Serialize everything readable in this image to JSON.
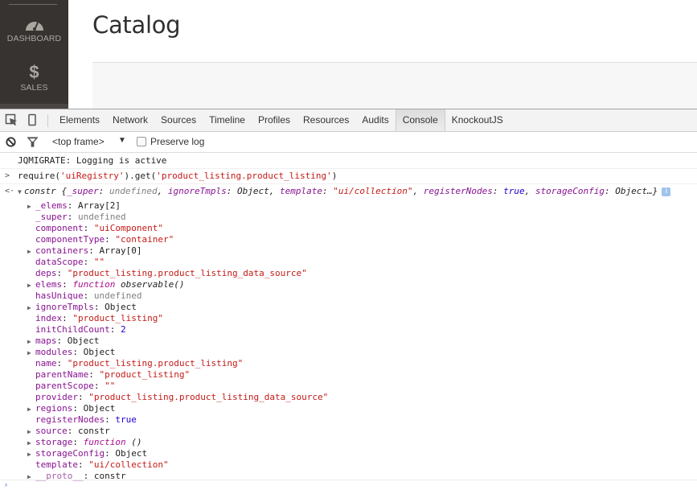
{
  "admin": {
    "sidebar": {
      "items": [
        {
          "label": "DASHBOARD",
          "icon": "gauge-icon"
        },
        {
          "label": "SALES",
          "icon": "dollar-icon",
          "glyph": "$"
        }
      ]
    },
    "page_title": "Catalog"
  },
  "devtools": {
    "tools": [
      "inspect-element-icon",
      "device-mode-icon"
    ],
    "tabs": [
      {
        "label": "Elements",
        "active": false
      },
      {
        "label": "Network",
        "active": false
      },
      {
        "label": "Sources",
        "active": false
      },
      {
        "label": "Timeline",
        "active": false
      },
      {
        "label": "Profiles",
        "active": false
      },
      {
        "label": "Resources",
        "active": false
      },
      {
        "label": "Audits",
        "active": false
      },
      {
        "label": "Console",
        "active": true
      },
      {
        "label": "KnockoutJS",
        "active": false
      }
    ],
    "toolbar": {
      "frame": "<top frame>",
      "frame_arrow": "▼",
      "preserve_log_label": "Preserve log",
      "preserve_log_checked": false
    },
    "console": {
      "log_message": "JQMIGRATE: Logging is active",
      "command_prompt": ">",
      "command": {
        "prefix": "require(",
        "arg1": "'uiRegistry'",
        "mid": ").get(",
        "arg2": "'product_listing.product_listing'",
        "suffix": ")"
      },
      "result_prompt": "<·",
      "result_summary": {
        "name": "constr",
        "open": " {",
        "p1k": "_super",
        "p1v": "undefined",
        "p2k": "ignoreTmpls",
        "p2v": "Object",
        "p3k": "template",
        "p3v": "\"ui/collection\"",
        "p4k": "registerNodes",
        "p4v": "true",
        "p5k": "storageConfig",
        "p5v": "Object…}",
        "info": "i"
      },
      "properties": [
        {
          "key": "_elems",
          "value": "Array[2]",
          "type": "obj",
          "expandable": true
        },
        {
          "key": "_super",
          "value": "undefined",
          "type": "undef",
          "expandable": false
        },
        {
          "key": "component",
          "value": "\"uiComponent\"",
          "type": "str",
          "expandable": false
        },
        {
          "key": "componentType",
          "value": "\"container\"",
          "type": "str",
          "expandable": false
        },
        {
          "key": "containers",
          "value": "Array[0]",
          "type": "obj",
          "expandable": true
        },
        {
          "key": "dataScope",
          "value": "\"\"",
          "type": "str",
          "expandable": false
        },
        {
          "key": "deps",
          "value": "\"product_listing.product_listing_data_source\"",
          "type": "str",
          "expandable": false
        },
        {
          "key": "elems",
          "value": "function",
          "value2": " observable()",
          "type": "fn",
          "expandable": true
        },
        {
          "key": "hasUnique",
          "value": "undefined",
          "type": "undef",
          "expandable": false
        },
        {
          "key": "ignoreTmpls",
          "value": "Object",
          "type": "obj",
          "expandable": true
        },
        {
          "key": "index",
          "value": "\"product_listing\"",
          "type": "str",
          "expandable": false
        },
        {
          "key": "initChildCount",
          "value": "2",
          "type": "num",
          "expandable": false
        },
        {
          "key": "maps",
          "value": "Object",
          "type": "obj",
          "expandable": true
        },
        {
          "key": "modules",
          "value": "Object",
          "type": "obj",
          "expandable": true
        },
        {
          "key": "name",
          "value": "\"product_listing.product_listing\"",
          "type": "str",
          "expandable": false
        },
        {
          "key": "parentName",
          "value": "\"product_listing\"",
          "type": "str",
          "expandable": false
        },
        {
          "key": "parentScope",
          "value": "\"\"",
          "type": "str",
          "expandable": false
        },
        {
          "key": "provider",
          "value": "\"product_listing.product_listing_data_source\"",
          "type": "str",
          "expandable": false
        },
        {
          "key": "regions",
          "value": "Object",
          "type": "obj",
          "expandable": true
        },
        {
          "key": "registerNodes",
          "value": "true",
          "type": "num",
          "expandable": false
        },
        {
          "key": "source",
          "value": "constr",
          "type": "obj",
          "expandable": true
        },
        {
          "key": "storage",
          "value": "function",
          "value2": " ()",
          "type": "fn",
          "expandable": true
        },
        {
          "key": "storageConfig",
          "value": "Object",
          "type": "obj",
          "expandable": true
        },
        {
          "key": "template",
          "value": "\"ui/collection\"",
          "type": "str",
          "expandable": false
        },
        {
          "key": "__proto__",
          "value": "constr",
          "type": "obj",
          "expandable": true,
          "dim": true
        }
      ],
      "input_caret": "›"
    }
  }
}
